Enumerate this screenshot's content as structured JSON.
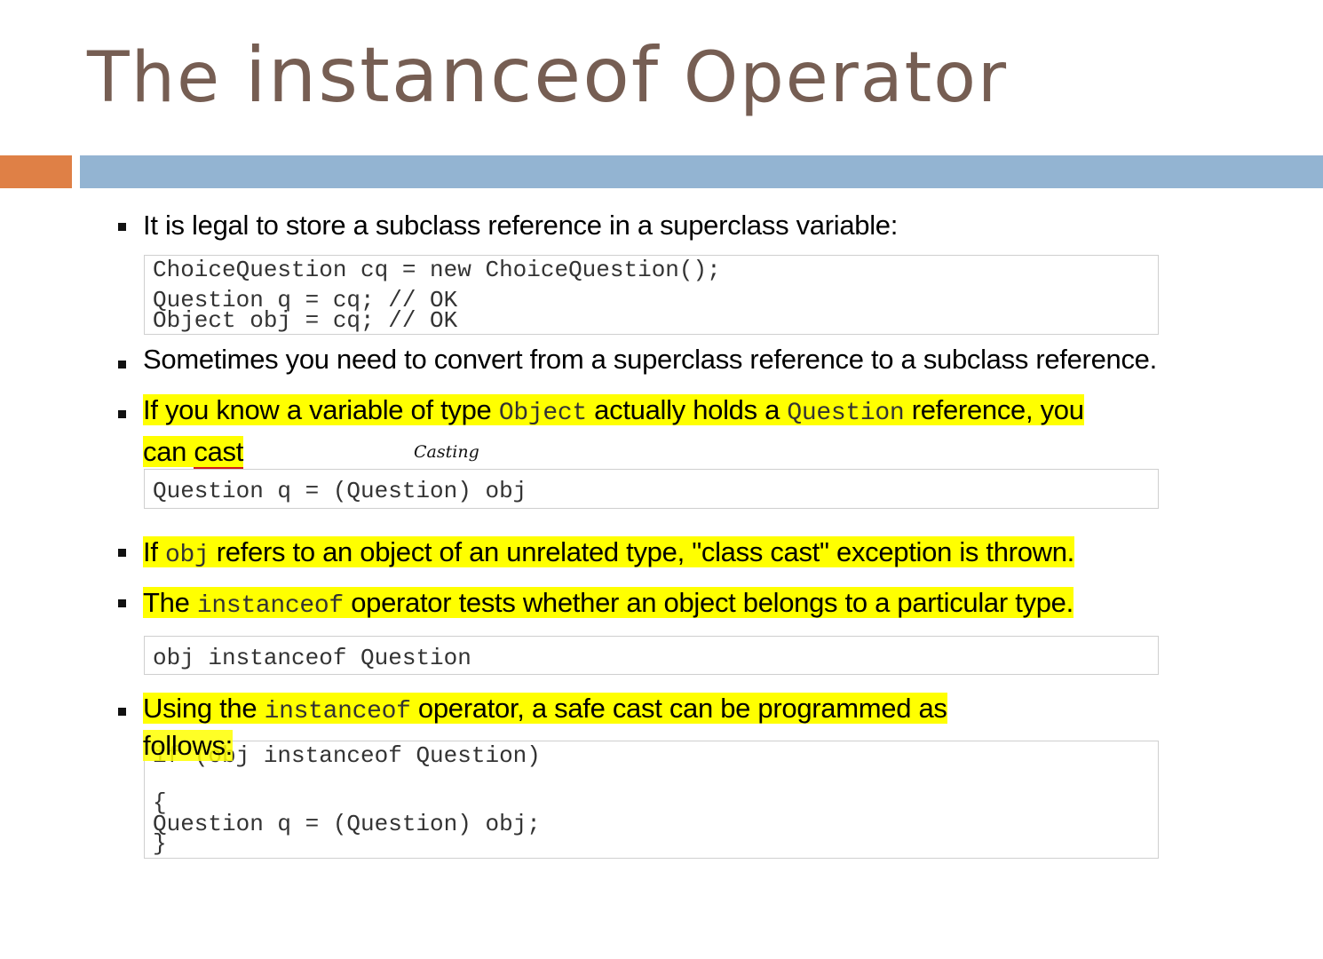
{
  "title": {
    "part1": "The ",
    "part2": "instanceof",
    "part3": " Operator"
  },
  "colors": {
    "title": "#765e53",
    "accent_orange": "#df8046",
    "accent_blue": "#93b4d2",
    "highlight": "#ffff00"
  },
  "bullets": {
    "b1": "It is legal to store a subclass reference in a superclass variable:",
    "b2": "Sometimes you need to convert from a superclass reference to a subclass  reference.",
    "b3": {
      "t1": "If you know a variable of type ",
      "c1": "Object",
      "t2": "  actually holds a ",
      "c2": "Question",
      "t3": "  reference, you",
      "t4": "can ",
      "t5": "cast"
    },
    "b4": {
      "t1": "If ",
      "c1": "obj",
      "t2": "  refers to an object of an unrelated type, \"class cast\" exception is thrown."
    },
    "b5": {
      "t1": "The ",
      "c1": "instanceof",
      "t2": "  operator tests whether an object belongs to a particular type."
    },
    "b6": {
      "t1": "Using the ",
      "c1": "instanceof",
      "t2": " operator, a safe cast can be programmed as",
      "t3": "follows:"
    }
  },
  "code": {
    "box1": [
      "ChoiceQuestion cq = new ChoiceQuestion();",
      "Question q = cq; // OK",
      "Object obj = cq; // OK"
    ],
    "box2": [
      "Question q = (Question) obj"
    ],
    "box3": [
      "obj instanceof Question"
    ],
    "box4": [
      "if (obj instanceof Question)",
      "{",
      "Question q = (Question) obj;",
      "}"
    ]
  },
  "annotation": "Casting"
}
